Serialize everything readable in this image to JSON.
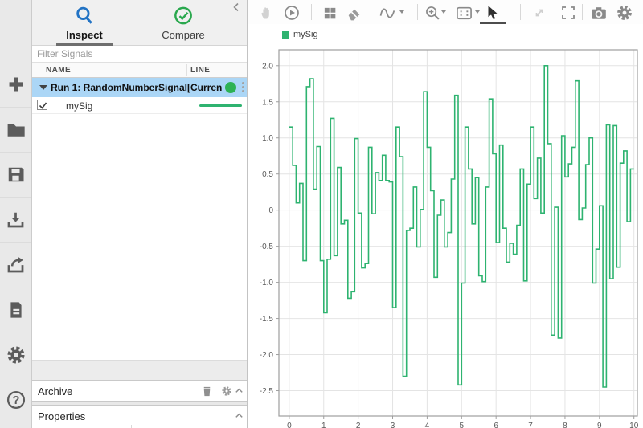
{
  "sidebar": {
    "icons": [
      "add",
      "open-folder",
      "save",
      "import",
      "export",
      "create-report",
      "preferences-gear",
      "help"
    ]
  },
  "tabs": {
    "inspect": "Inspect",
    "compare": "Compare"
  },
  "filter": {
    "placeholder": "Filter Signals"
  },
  "signals": {
    "columns": [
      "NAME",
      "LINE"
    ],
    "run": {
      "label": "Run 1: RandomNumberSignal[Curren",
      "expanded": true,
      "dot_color": "#2db254"
    },
    "rows": [
      {
        "name": "mySig",
        "checked": true,
        "line_color": "#2eb370"
      }
    ]
  },
  "panels": {
    "archive": "Archive",
    "properties": "Properties"
  },
  "plot_toolbar": {
    "icons": [
      "pan-hand",
      "replay",
      "layout-grid",
      "eraser",
      "signal-wave",
      "zoom-in",
      "fit-to-view",
      "cursor-arrow",
      "pan-diagonal",
      "fullscreen",
      "snapshot-camera",
      "settings-gear"
    ],
    "active": "cursor-arrow",
    "disabled": [
      "pan-hand",
      "pan-diagonal"
    ]
  },
  "chart_data": {
    "type": "stair",
    "legend": [
      {
        "label": "mySig",
        "color": "#2eb370"
      }
    ],
    "line_color": "#2eb370",
    "grid": true,
    "x_start": 0,
    "x_step": 0.1,
    "xlim": [
      -0.3,
      10.1
    ],
    "ylim": [
      -2.85,
      2.22
    ],
    "xticks": [
      0,
      1,
      2,
      3,
      4,
      5,
      6,
      7,
      8,
      9,
      10
    ],
    "xtick_labels": [
      "0",
      "1",
      "2",
      "3",
      "4",
      "5",
      "6",
      "7",
      "8",
      "9",
      "10"
    ],
    "yticks": [
      2.0,
      1.5,
      1.0,
      0.5,
      0,
      -0.5,
      -1.0,
      -1.5,
      -2.0,
      -2.5
    ],
    "ytick_labels": [
      "2.0",
      "1.5",
      "1.0",
      "0.5",
      "0",
      "-0.5",
      "-1.0",
      "-1.5",
      "-2.0",
      "-2.5"
    ],
    "values": [
      1.15,
      0.62,
      0.1,
      0.37,
      -0.7,
      1.71,
      1.82,
      0.29,
      0.88,
      -0.7,
      -1.42,
      -0.68,
      1.27,
      -0.63,
      0.59,
      -0.19,
      -0.14,
      -1.22,
      -1.13,
      0.99,
      -0.04,
      -0.8,
      -0.74,
      0.87,
      -0.05,
      0.52,
      0.41,
      0.76,
      0.41,
      0.39,
      -1.35,
      1.15,
      0.74,
      -2.3,
      -0.28,
      -0.25,
      0.32,
      -0.51,
      0.01,
      1.64,
      0.87,
      0.27,
      -0.93,
      -0.07,
      0.14,
      -0.51,
      -0.31,
      0.43,
      1.59,
      -2.42,
      -1.01,
      1.15,
      0.57,
      -0.19,
      0.45,
      -0.91,
      -0.99,
      0.32,
      1.54,
      0.78,
      -0.45,
      0.9,
      -0.25,
      -0.72,
      -0.46,
      -0.61,
      -0.21,
      0.57,
      -0.98,
      0.36,
      1.15,
      0.16,
      0.72,
      -0.04,
      2.0,
      0.92,
      -1.73,
      0.04,
      -1.77,
      1.03,
      0.46,
      0.64,
      0.87,
      1.79,
      -0.13,
      0.03,
      0.63,
      1.0,
      -1.01,
      -0.54,
      0.06,
      -2.45,
      1.18,
      -0.95,
      1.17,
      -0.79,
      0.65,
      0.82,
      -0.16,
      0.57
    ]
  }
}
